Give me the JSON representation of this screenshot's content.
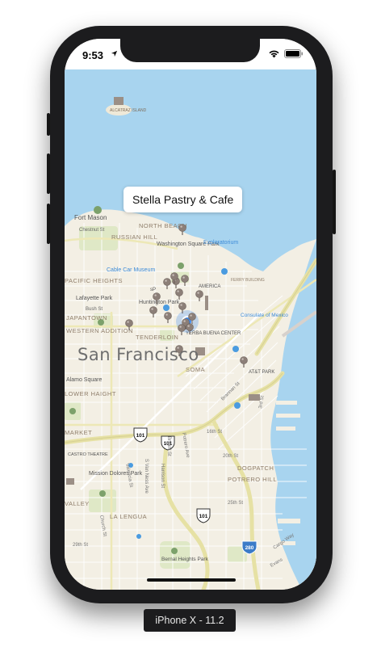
{
  "status_bar": {
    "time": "9:53"
  },
  "callout": {
    "title": "Stella Pastry & Cafe"
  },
  "map": {
    "city_label": "San Francisco",
    "labels": [
      {
        "id": "alcatraz",
        "text": "ALCATRAZ ISLAND"
      },
      {
        "id": "fort-mason",
        "text": "Fort Mason"
      },
      {
        "id": "chestnut",
        "text": "Chestnut St"
      },
      {
        "id": "north-beach",
        "text": "NORTH BEACH"
      },
      {
        "id": "russian-hill",
        "text": "RUSSIAN HILL"
      },
      {
        "id": "washington-sq",
        "text": "Washington Square Park"
      },
      {
        "id": "exploratorium",
        "text": "Exploratorium"
      },
      {
        "id": "cable-car",
        "text": "Cable Car Museum"
      },
      {
        "id": "pacific-heights",
        "text": "PACIFIC HEIGHTS"
      },
      {
        "id": "huntington",
        "text": "Huntington Park"
      },
      {
        "id": "lafayette",
        "text": "Lafayette Park"
      },
      {
        "id": "bush",
        "text": "Bush St"
      },
      {
        "id": "japantown",
        "text": "JAPANTOWN"
      },
      {
        "id": "western-add",
        "text": "WESTERN ADDITION"
      },
      {
        "id": "tenderloin",
        "text": "TENDERLOIN"
      },
      {
        "id": "yerba",
        "text": "YERBA BUENA CENTER"
      },
      {
        "id": "america",
        "text": "AMERICA"
      },
      {
        "id": "consulate",
        "text": "Consulate of Mexico"
      },
      {
        "id": "soma",
        "text": "SOMA"
      },
      {
        "id": "att-park",
        "text": "AT&T PARK"
      },
      {
        "id": "brannan",
        "text": "Brannan St"
      },
      {
        "id": "third",
        "text": "3rd St"
      },
      {
        "id": "alamo",
        "text": "Alamo Square"
      },
      {
        "id": "lower-haight",
        "text": "LOWER HAIGHT"
      },
      {
        "id": "market",
        "text": "MARKET"
      },
      {
        "id": "castro",
        "text": "CASTRO THEATRE"
      },
      {
        "id": "sixteenth",
        "text": "16th St"
      },
      {
        "id": "bryant",
        "text": "Bryant St"
      },
      {
        "id": "potrero",
        "text": "Potrero Ave"
      },
      {
        "id": "twentieth",
        "text": "20th St"
      },
      {
        "id": "dogpatch",
        "text": "DOGPATCH"
      },
      {
        "id": "potrero-hill",
        "text": "POTRERO HILL"
      },
      {
        "id": "mission-dolores",
        "text": "Mission Dolores Park"
      },
      {
        "id": "valencia",
        "text": "Valencia St"
      },
      {
        "id": "harrison",
        "text": "Harrison St"
      },
      {
        "id": "van-ness",
        "text": "S Van Ness Ave"
      },
      {
        "id": "twentyfifth",
        "text": "25th St"
      },
      {
        "id": "valley",
        "text": "VALLEY"
      },
      {
        "id": "la-lengua",
        "text": "LA LENGUA"
      },
      {
        "id": "church",
        "text": "Church St"
      },
      {
        "id": "twentyninth",
        "text": "29th St"
      },
      {
        "id": "bernal",
        "text": "Bernal Heights Park"
      },
      {
        "id": "cargo",
        "text": "Cargo Way"
      },
      {
        "id": "evans",
        "text": "Evans"
      },
      {
        "id": "ferry",
        "text": "FERRY BUILDING"
      },
      {
        "id": "sp",
        "text": "sP"
      }
    ],
    "shields": [
      {
        "id": "shield-101-a",
        "text": "101"
      },
      {
        "id": "shield-101-b",
        "text": "101"
      },
      {
        "id": "shield-101-c",
        "text": "101"
      },
      {
        "id": "shield-280",
        "text": "280"
      }
    ],
    "pin_count": 18
  },
  "device": {
    "simulator_label": "iPhone X - 11.2"
  },
  "colors": {
    "water": "#a8d4ef",
    "land": "#f3efe4",
    "park": "#dfe8c6",
    "highway": "#e6e1a4",
    "pin": "#8c7f78",
    "user_location": "#3d8bf0"
  }
}
